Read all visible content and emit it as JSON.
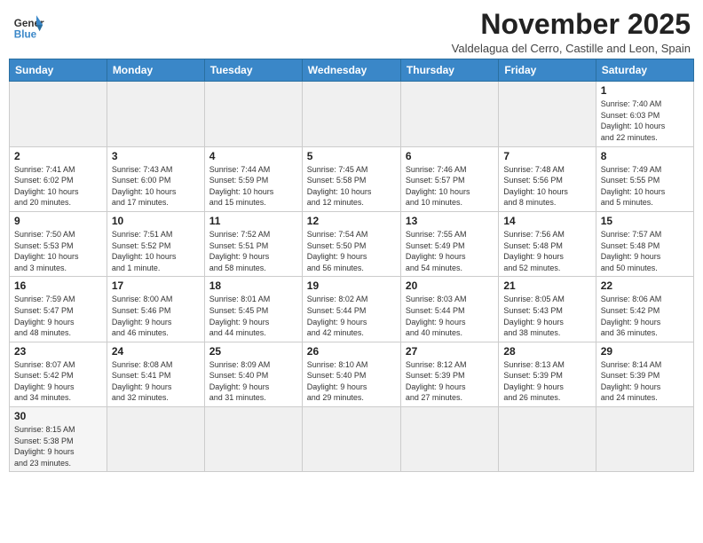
{
  "header": {
    "logo_general": "General",
    "logo_blue": "Blue",
    "month_year": "November 2025",
    "location": "Valdelagua del Cerro, Castille and Leon, Spain"
  },
  "weekdays": [
    "Sunday",
    "Monday",
    "Tuesday",
    "Wednesday",
    "Thursday",
    "Friday",
    "Saturday"
  ],
  "days": [
    {
      "num": "",
      "info": "",
      "empty": true
    },
    {
      "num": "",
      "info": "",
      "empty": true
    },
    {
      "num": "",
      "info": "",
      "empty": true
    },
    {
      "num": "",
      "info": "",
      "empty": true
    },
    {
      "num": "",
      "info": "",
      "empty": true
    },
    {
      "num": "",
      "info": "",
      "empty": true
    },
    {
      "num": "1",
      "info": "Sunrise: 7:40 AM\nSunset: 6:03 PM\nDaylight: 10 hours\nand 22 minutes.",
      "empty": false
    },
    {
      "num": "2",
      "info": "Sunrise: 7:41 AM\nSunset: 6:02 PM\nDaylight: 10 hours\nand 20 minutes.",
      "empty": false
    },
    {
      "num": "3",
      "info": "Sunrise: 7:43 AM\nSunset: 6:00 PM\nDaylight: 10 hours\nand 17 minutes.",
      "empty": false
    },
    {
      "num": "4",
      "info": "Sunrise: 7:44 AM\nSunset: 5:59 PM\nDaylight: 10 hours\nand 15 minutes.",
      "empty": false
    },
    {
      "num": "5",
      "info": "Sunrise: 7:45 AM\nSunset: 5:58 PM\nDaylight: 10 hours\nand 12 minutes.",
      "empty": false
    },
    {
      "num": "6",
      "info": "Sunrise: 7:46 AM\nSunset: 5:57 PM\nDaylight: 10 hours\nand 10 minutes.",
      "empty": false
    },
    {
      "num": "7",
      "info": "Sunrise: 7:48 AM\nSunset: 5:56 PM\nDaylight: 10 hours\nand 8 minutes.",
      "empty": false
    },
    {
      "num": "8",
      "info": "Sunrise: 7:49 AM\nSunset: 5:55 PM\nDaylight: 10 hours\nand 5 minutes.",
      "empty": false
    },
    {
      "num": "9",
      "info": "Sunrise: 7:50 AM\nSunset: 5:53 PM\nDaylight: 10 hours\nand 3 minutes.",
      "empty": false
    },
    {
      "num": "10",
      "info": "Sunrise: 7:51 AM\nSunset: 5:52 PM\nDaylight: 10 hours\nand 1 minute.",
      "empty": false
    },
    {
      "num": "11",
      "info": "Sunrise: 7:52 AM\nSunset: 5:51 PM\nDaylight: 9 hours\nand 58 minutes.",
      "empty": false
    },
    {
      "num": "12",
      "info": "Sunrise: 7:54 AM\nSunset: 5:50 PM\nDaylight: 9 hours\nand 56 minutes.",
      "empty": false
    },
    {
      "num": "13",
      "info": "Sunrise: 7:55 AM\nSunset: 5:49 PM\nDaylight: 9 hours\nand 54 minutes.",
      "empty": false
    },
    {
      "num": "14",
      "info": "Sunrise: 7:56 AM\nSunset: 5:48 PM\nDaylight: 9 hours\nand 52 minutes.",
      "empty": false
    },
    {
      "num": "15",
      "info": "Sunrise: 7:57 AM\nSunset: 5:48 PM\nDaylight: 9 hours\nand 50 minutes.",
      "empty": false
    },
    {
      "num": "16",
      "info": "Sunrise: 7:59 AM\nSunset: 5:47 PM\nDaylight: 9 hours\nand 48 minutes.",
      "empty": false
    },
    {
      "num": "17",
      "info": "Sunrise: 8:00 AM\nSunset: 5:46 PM\nDaylight: 9 hours\nand 46 minutes.",
      "empty": false
    },
    {
      "num": "18",
      "info": "Sunrise: 8:01 AM\nSunset: 5:45 PM\nDaylight: 9 hours\nand 44 minutes.",
      "empty": false
    },
    {
      "num": "19",
      "info": "Sunrise: 8:02 AM\nSunset: 5:44 PM\nDaylight: 9 hours\nand 42 minutes.",
      "empty": false
    },
    {
      "num": "20",
      "info": "Sunrise: 8:03 AM\nSunset: 5:44 PM\nDaylight: 9 hours\nand 40 minutes.",
      "empty": false
    },
    {
      "num": "21",
      "info": "Sunrise: 8:05 AM\nSunset: 5:43 PM\nDaylight: 9 hours\nand 38 minutes.",
      "empty": false
    },
    {
      "num": "22",
      "info": "Sunrise: 8:06 AM\nSunset: 5:42 PM\nDaylight: 9 hours\nand 36 minutes.",
      "empty": false
    },
    {
      "num": "23",
      "info": "Sunrise: 8:07 AM\nSunset: 5:42 PM\nDaylight: 9 hours\nand 34 minutes.",
      "empty": false
    },
    {
      "num": "24",
      "info": "Sunrise: 8:08 AM\nSunset: 5:41 PM\nDaylight: 9 hours\nand 32 minutes.",
      "empty": false
    },
    {
      "num": "25",
      "info": "Sunrise: 8:09 AM\nSunset: 5:40 PM\nDaylight: 9 hours\nand 31 minutes.",
      "empty": false
    },
    {
      "num": "26",
      "info": "Sunrise: 8:10 AM\nSunset: 5:40 PM\nDaylight: 9 hours\nand 29 minutes.",
      "empty": false
    },
    {
      "num": "27",
      "info": "Sunrise: 8:12 AM\nSunset: 5:39 PM\nDaylight: 9 hours\nand 27 minutes.",
      "empty": false
    },
    {
      "num": "28",
      "info": "Sunrise: 8:13 AM\nSunset: 5:39 PM\nDaylight: 9 hours\nand 26 minutes.",
      "empty": false
    },
    {
      "num": "29",
      "info": "Sunrise: 8:14 AM\nSunset: 5:39 PM\nDaylight: 9 hours\nand 24 minutes.",
      "empty": false
    },
    {
      "num": "30",
      "info": "Sunrise: 8:15 AM\nSunset: 5:38 PM\nDaylight: 9 hours\nand 23 minutes.",
      "empty": false
    },
    {
      "num": "",
      "info": "",
      "empty": true
    },
    {
      "num": "",
      "info": "",
      "empty": true
    },
    {
      "num": "",
      "info": "",
      "empty": true
    },
    {
      "num": "",
      "info": "",
      "empty": true
    },
    {
      "num": "",
      "info": "",
      "empty": true
    },
    {
      "num": "",
      "info": "",
      "empty": true
    }
  ]
}
